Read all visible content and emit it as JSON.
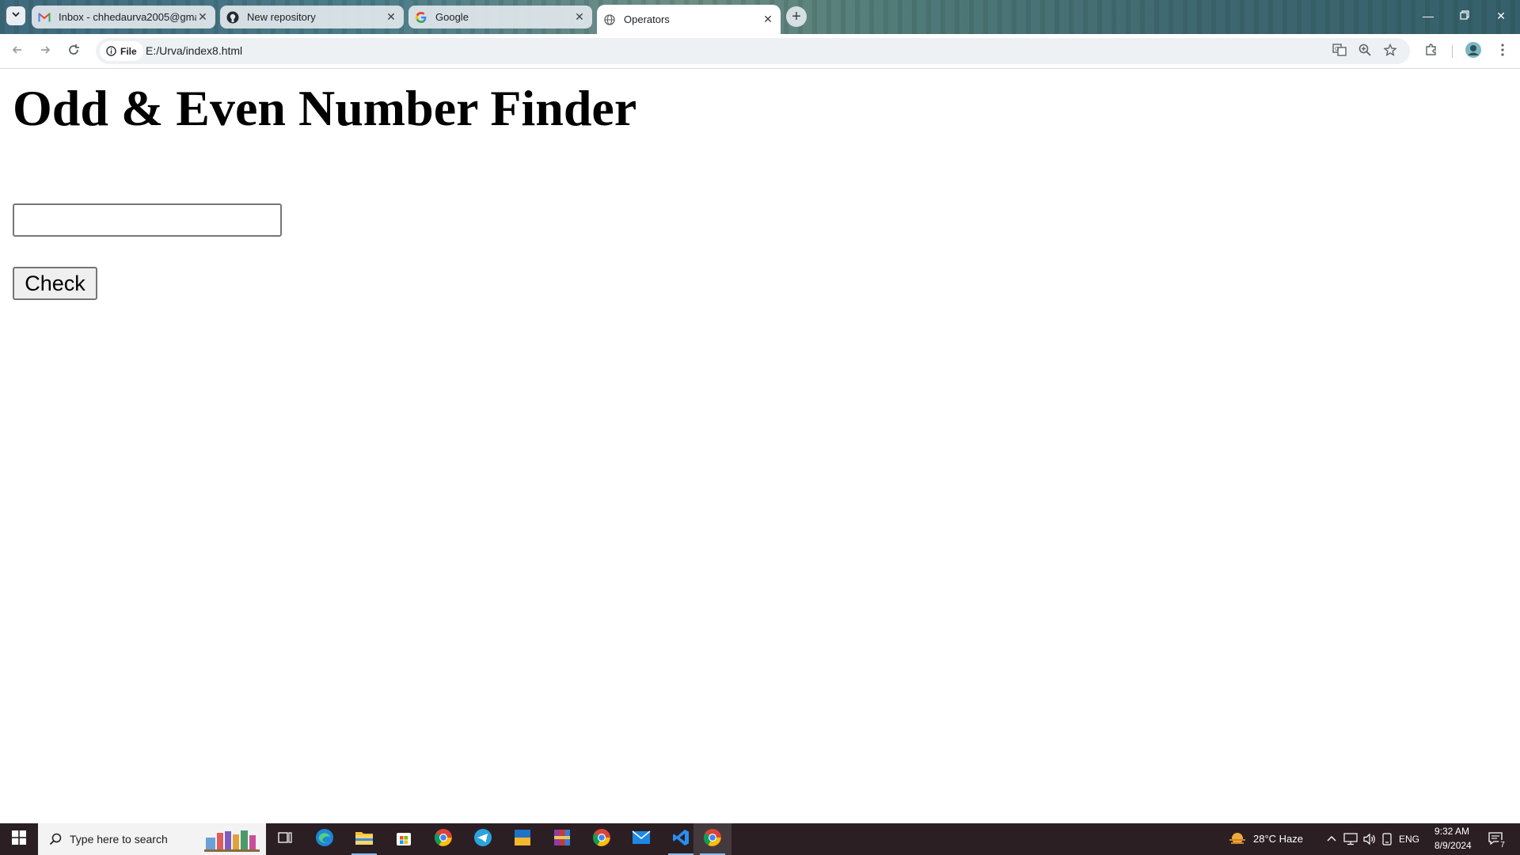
{
  "browser": {
    "tabs": [
      {
        "title": "Inbox - chhedaurva2005@gma",
        "icon": "gmail-icon"
      },
      {
        "title": "New repository",
        "icon": "github-icon"
      },
      {
        "title": "Google",
        "icon": "google-icon"
      },
      {
        "title": "Operators",
        "icon": "globe-icon",
        "active": true
      }
    ],
    "address_chip": "File",
    "url": "E:/Urva/index8.html"
  },
  "page": {
    "heading": "Odd & Even Number Finder",
    "input_value": "",
    "button_label": "Check"
  },
  "taskbar": {
    "search_placeholder": "Type here to search",
    "weather": "28°C  Haze",
    "language": "ENG",
    "time": "9:32 AM",
    "date": "8/9/2024",
    "notification_count": "7"
  }
}
